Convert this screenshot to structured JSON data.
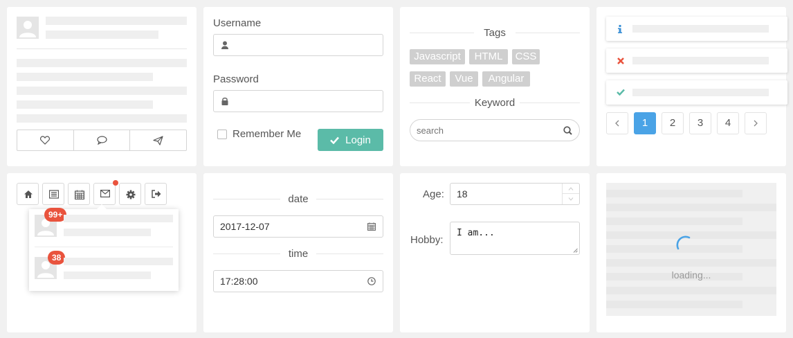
{
  "login": {
    "username_label": "Username",
    "password_label": "Password",
    "remember_label": "Remember Me",
    "login_button": "Login"
  },
  "tags": {
    "title": "Tags",
    "items": [
      "Javascript",
      "HTML",
      "CSS",
      "React",
      "Vue",
      "Angular"
    ],
    "keyword_title": "Keyword",
    "search_placeholder": "search"
  },
  "pagination": {
    "pages": [
      "1",
      "2",
      "3",
      "4"
    ],
    "active": "1"
  },
  "notifications": {
    "badge_1": "99+",
    "badge_2": "38"
  },
  "datetime": {
    "date_title": "date",
    "date_value": "2017-12-07",
    "time_title": "time",
    "time_value": "17:28:00"
  },
  "form": {
    "age_label": "Age:",
    "age_value": "18",
    "hobby_label": "Hobby:",
    "hobby_value": "I am..."
  },
  "loader": {
    "text": "loading..."
  },
  "colors": {
    "accent": "#4aa3e6",
    "success": "#5bbba8",
    "badge": "#e9533d",
    "tag": "#cfcfcf"
  },
  "icons": [
    "user-icon",
    "heart-icon",
    "comment-icon",
    "send-icon",
    "lock-icon",
    "check-icon",
    "search-icon",
    "info-icon",
    "close-icon",
    "home-icon",
    "list-icon",
    "calendar-icon",
    "mail-icon",
    "gear-icon",
    "sign-out-icon",
    "clock-icon"
  ]
}
